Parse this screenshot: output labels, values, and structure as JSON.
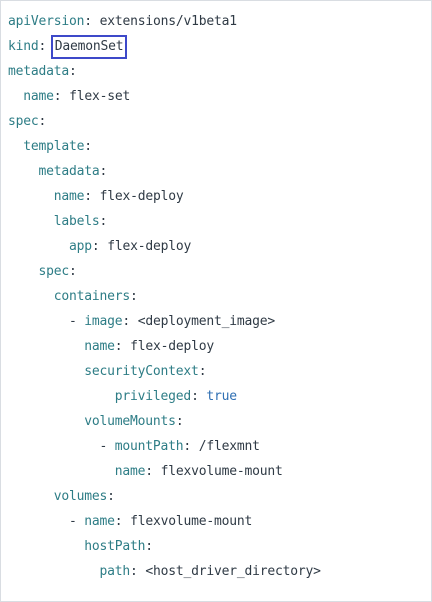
{
  "manifest": {
    "lines": [
      {
        "indent": "",
        "key": "apiVersion",
        "value": "extensions/v1beta1"
      },
      {
        "indent": "",
        "key": "kind",
        "value": "DaemonSet",
        "highlighted": true
      },
      {
        "indent": "",
        "key": "metadata",
        "value": ""
      },
      {
        "indent": "  ",
        "key": "name",
        "value": "flex-set"
      },
      {
        "indent": "",
        "key": "spec",
        "value": ""
      },
      {
        "indent": "  ",
        "key": "template",
        "value": ""
      },
      {
        "indent": "    ",
        "key": "metadata",
        "value": ""
      },
      {
        "indent": "      ",
        "key": "name",
        "value": "flex-deploy"
      },
      {
        "indent": "      ",
        "key": "labels",
        "value": ""
      },
      {
        "indent": "        ",
        "key": "app",
        "value": "flex-deploy"
      },
      {
        "indent": "    ",
        "key": "spec",
        "value": ""
      },
      {
        "indent": "      ",
        "key": "containers",
        "value": ""
      },
      {
        "indent": "        - ",
        "key": "image",
        "value": "<deployment_image>"
      },
      {
        "indent": "          ",
        "key": "name",
        "value": "flex-deploy"
      },
      {
        "indent": "          ",
        "key": "securityContext",
        "value": ""
      },
      {
        "indent": "              ",
        "key": "privileged",
        "value": "true",
        "bool": true
      },
      {
        "indent": "          ",
        "key": "volumeMounts",
        "value": ""
      },
      {
        "indent": "            - ",
        "key": "mountPath",
        "value": "/flexmnt"
      },
      {
        "indent": "              ",
        "key": "name",
        "value": "flexvolume-mount"
      },
      {
        "indent": "      ",
        "key": "volumes",
        "value": ""
      },
      {
        "indent": "        - ",
        "key": "name",
        "value": "flexvolume-mount"
      },
      {
        "indent": "          ",
        "key": "hostPath",
        "value": ""
      },
      {
        "indent": "            ",
        "key": "path",
        "value": "<host_driver_directory>"
      }
    ]
  },
  "colors": {
    "key": "#2e7d86",
    "text": "#2f3a45",
    "boolean": "#2f6fb3",
    "highlight_border": "#3d49c9"
  }
}
